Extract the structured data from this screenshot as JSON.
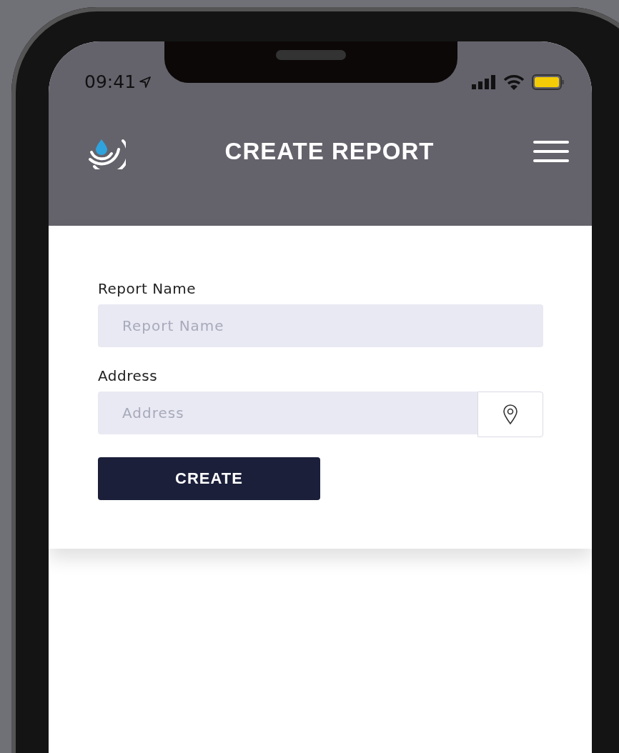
{
  "status_bar": {
    "time": "09:41"
  },
  "header": {
    "title": "CREATE REPORT"
  },
  "form": {
    "fields": [
      {
        "label": "Report Name",
        "placeholder": "Report Name",
        "kind": "text"
      },
      {
        "label": "Address",
        "placeholder": "Address",
        "kind": "location"
      }
    ],
    "submit": "CREATE"
  }
}
